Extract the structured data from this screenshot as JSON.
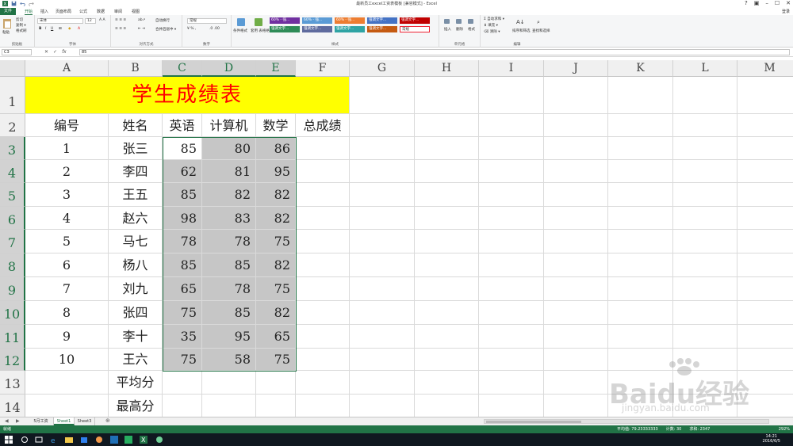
{
  "window": {
    "title": "最新员工excel工资表模板 [兼容模式] - Excel",
    "login": "登录"
  },
  "ribbon_tabs": [
    "文件",
    "开始",
    "插入",
    "页面布局",
    "公式",
    "数据",
    "审阅",
    "视图"
  ],
  "ribbon": {
    "clipboard": {
      "paste": "粘贴",
      "cut": "剪切",
      "copy": "复制 ▾",
      "format_painter": "格式刷",
      "label": "剪贴板"
    },
    "font": {
      "name": "宋体",
      "size": "12",
      "label": "字体"
    },
    "alignment": {
      "wrap": "自动换行",
      "merge": "合并后居中 ▾",
      "label": "对齐方式"
    },
    "number": {
      "format": "常规",
      "label": "数字"
    },
    "styles": {
      "conditional": "条件格式",
      "table": "套用\n表格格式",
      "tiles": [
        "60% - 强...",
        "60% - 强...",
        "60% - 强...",
        "强调文字...",
        "强调文字...",
        "强调文字...",
        "强调文字...",
        "强调文字...",
        "强调文字...",
        "常规"
      ],
      "label": "样式"
    },
    "cells": {
      "insert": "插入",
      "delete": "删除",
      "format": "格式",
      "label": "单元格"
    },
    "editing": {
      "autosum": "自动求和 ▾",
      "fill": "填充 ▾",
      "clear": "清除 ▾",
      "sort": "排序和筛选",
      "find": "查找和选择",
      "label": "编辑"
    }
  },
  "formula_bar": {
    "name_box": "C3",
    "formula": "85"
  },
  "columns": [
    "A",
    "B",
    "C",
    "D",
    "E",
    "F",
    "G",
    "H",
    "I",
    "J",
    "K",
    "L",
    "M"
  ],
  "rows": [
    "1",
    "2",
    "3",
    "4",
    "5",
    "6",
    "7",
    "8",
    "9",
    "10",
    "11",
    "12",
    "13",
    "14"
  ],
  "sheet": {
    "title": "学生成绩表",
    "headers": [
      "编号",
      "姓名",
      "英语",
      "计算机",
      "数学",
      "总成绩"
    ],
    "records": [
      {
        "id": "1",
        "name": "张三",
        "english": "85",
        "computer": "80",
        "math": "86"
      },
      {
        "id": "2",
        "name": "李四",
        "english": "62",
        "computer": "81",
        "math": "95"
      },
      {
        "id": "3",
        "name": "王五",
        "english": "85",
        "computer": "82",
        "math": "82"
      },
      {
        "id": "4",
        "name": "赵六",
        "english": "98",
        "computer": "83",
        "math": "82"
      },
      {
        "id": "5",
        "name": "马七",
        "english": "78",
        "computer": "78",
        "math": "75"
      },
      {
        "id": "6",
        "name": "杨八",
        "english": "85",
        "computer": "85",
        "math": "82"
      },
      {
        "id": "7",
        "name": "刘九",
        "english": "65",
        "computer": "78",
        "math": "75"
      },
      {
        "id": "8",
        "name": "张四",
        "english": "75",
        "computer": "85",
        "math": "82"
      },
      {
        "id": "9",
        "name": "李十",
        "english": "35",
        "computer": "95",
        "math": "65"
      },
      {
        "id": "10",
        "name": "王六",
        "english": "75",
        "computer": "58",
        "math": "75"
      }
    ],
    "average_label": "平均分",
    "max_label": "最高分"
  },
  "sheet_tabs": [
    "5月工资",
    "Sheet1",
    "Sheet3"
  ],
  "status": {
    "mode": "就绪",
    "average": "平均值: 79.23333333",
    "count": "计数: 30",
    "sum": "求和: 2347",
    "zoom": "292%"
  },
  "taskbar": {
    "time": "14:21",
    "date": "2016/6/5"
  },
  "watermark": {
    "text": "Baidu经验",
    "url": "jingyan.baidu.com"
  },
  "colors": {
    "excel_green": "#217346",
    "title_fill": "#ffff00",
    "title_text": "#ff0000",
    "selection_fill": "#c6c6c6"
  }
}
